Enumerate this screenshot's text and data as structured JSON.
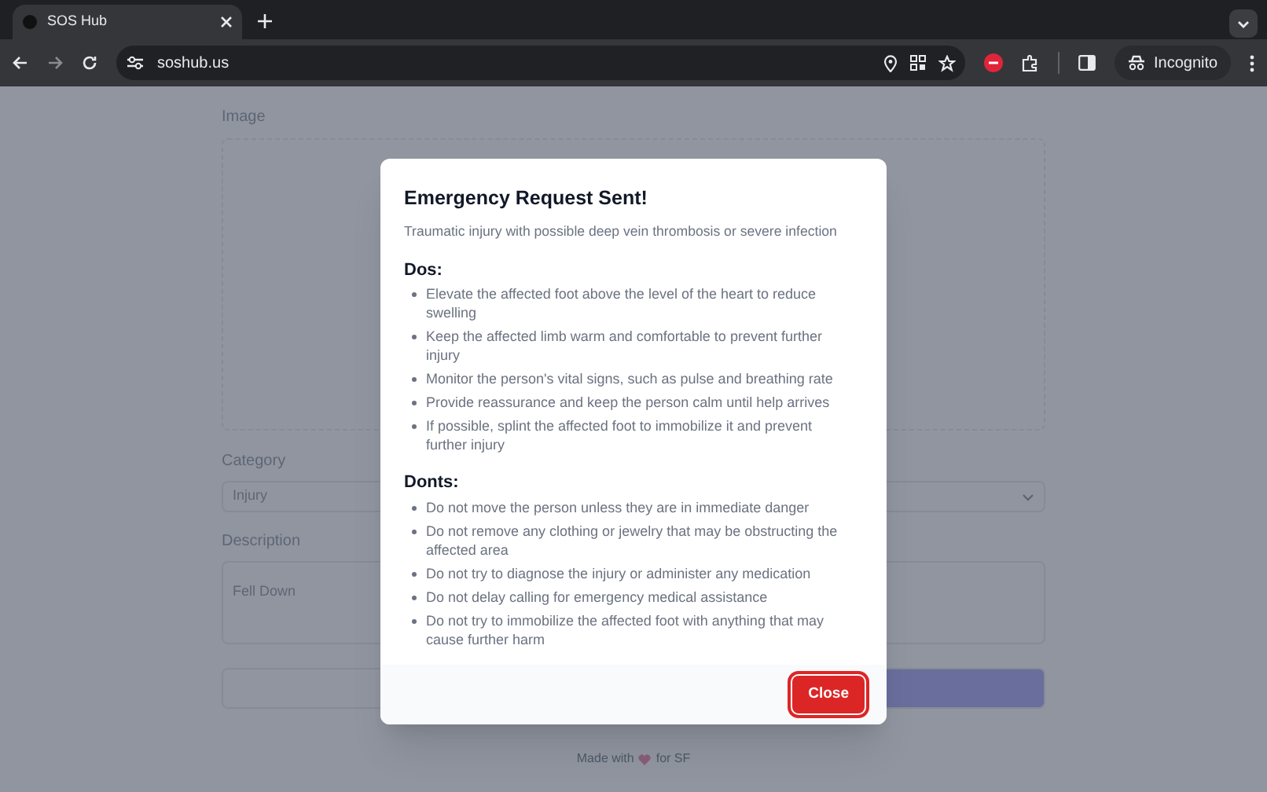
{
  "browser": {
    "tab_title": "SOS Hub",
    "url": "soshub.us",
    "profile": "Incognito"
  },
  "form": {
    "image_label": "Image",
    "category_label": "Category",
    "category_value": "Injury",
    "description_label": "Description",
    "description_value": "Fell Down"
  },
  "footer": {
    "before": "Made with",
    "after": "for SF"
  },
  "modal": {
    "title": "Emergency Request Sent!",
    "summary": "Traumatic injury with possible deep vein thrombosis or severe infection",
    "sections": [
      {
        "heading": "Dos:",
        "items": [
          "Elevate the affected foot above the level of the heart to reduce swelling",
          "Keep the affected limb warm and comfortable to prevent further injury",
          "Monitor the person's vital signs, such as pulse and breathing rate",
          "Provide reassurance and keep the person calm until help arrives",
          "If possible, splint the affected foot to immobilize it and prevent further injury"
        ]
      },
      {
        "heading": "Donts:",
        "items": [
          "Do not move the person unless they are in immediate danger",
          "Do not remove any clothing or jewelry that may be obstructing the affected area",
          "Do not try to diagnose the injury or administer any medication",
          "Do not delay calling for emergency medical assistance",
          "Do not try to immobilize the affected foot with anything that may cause further harm"
        ]
      }
    ],
    "button": "Close"
  }
}
